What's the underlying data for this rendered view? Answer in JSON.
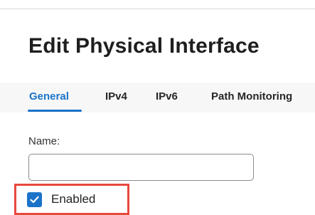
{
  "dialog": {
    "title": "Edit Physical Interface"
  },
  "tabs": [
    {
      "label": "General",
      "active": true
    },
    {
      "label": "IPv4",
      "active": false
    },
    {
      "label": "IPv6",
      "active": false
    },
    {
      "label": "Path Monitoring",
      "active": false
    }
  ],
  "form": {
    "name_label": "Name:",
    "name_value": "",
    "enabled_label": "Enabled",
    "enabled_checked": true
  },
  "colors": {
    "accent": "#1a73c8",
    "highlight": "#e8483f"
  }
}
